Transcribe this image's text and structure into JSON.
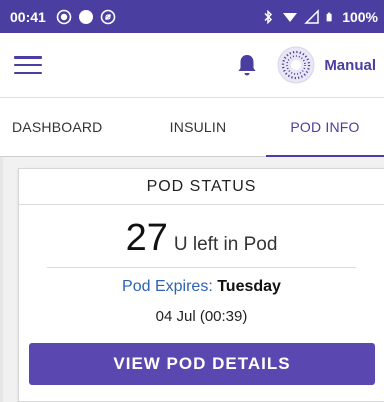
{
  "status_bar": {
    "time": "00:41",
    "battery_text": "100%",
    "icons": [
      "record-icon",
      "circle-icon",
      "do-not-disturb-icon",
      "bluetooth-icon",
      "signal-icon",
      "cell-icon",
      "battery-icon"
    ]
  },
  "header": {
    "mode_label": "Manual",
    "icons": [
      "menu-icon",
      "bell-icon",
      "mode-icon"
    ]
  },
  "tabs": [
    {
      "label": "DASHBOARD",
      "active": false
    },
    {
      "label": "INSULIN",
      "active": false
    },
    {
      "label": "POD INFO",
      "active": true
    }
  ],
  "pod_status": {
    "title": "POD STATUS",
    "units_value": "27",
    "units_text": "U left in Pod",
    "expires_label": "Pod Expires:",
    "expires_day": "Tuesday",
    "expires_date": "04 Jul (00:39)",
    "button_label": "VIEW POD DETAILS"
  },
  "colors": {
    "primary": "#4a3fa0",
    "button": "#5a48b0",
    "link_blue": "#2d63b3"
  }
}
